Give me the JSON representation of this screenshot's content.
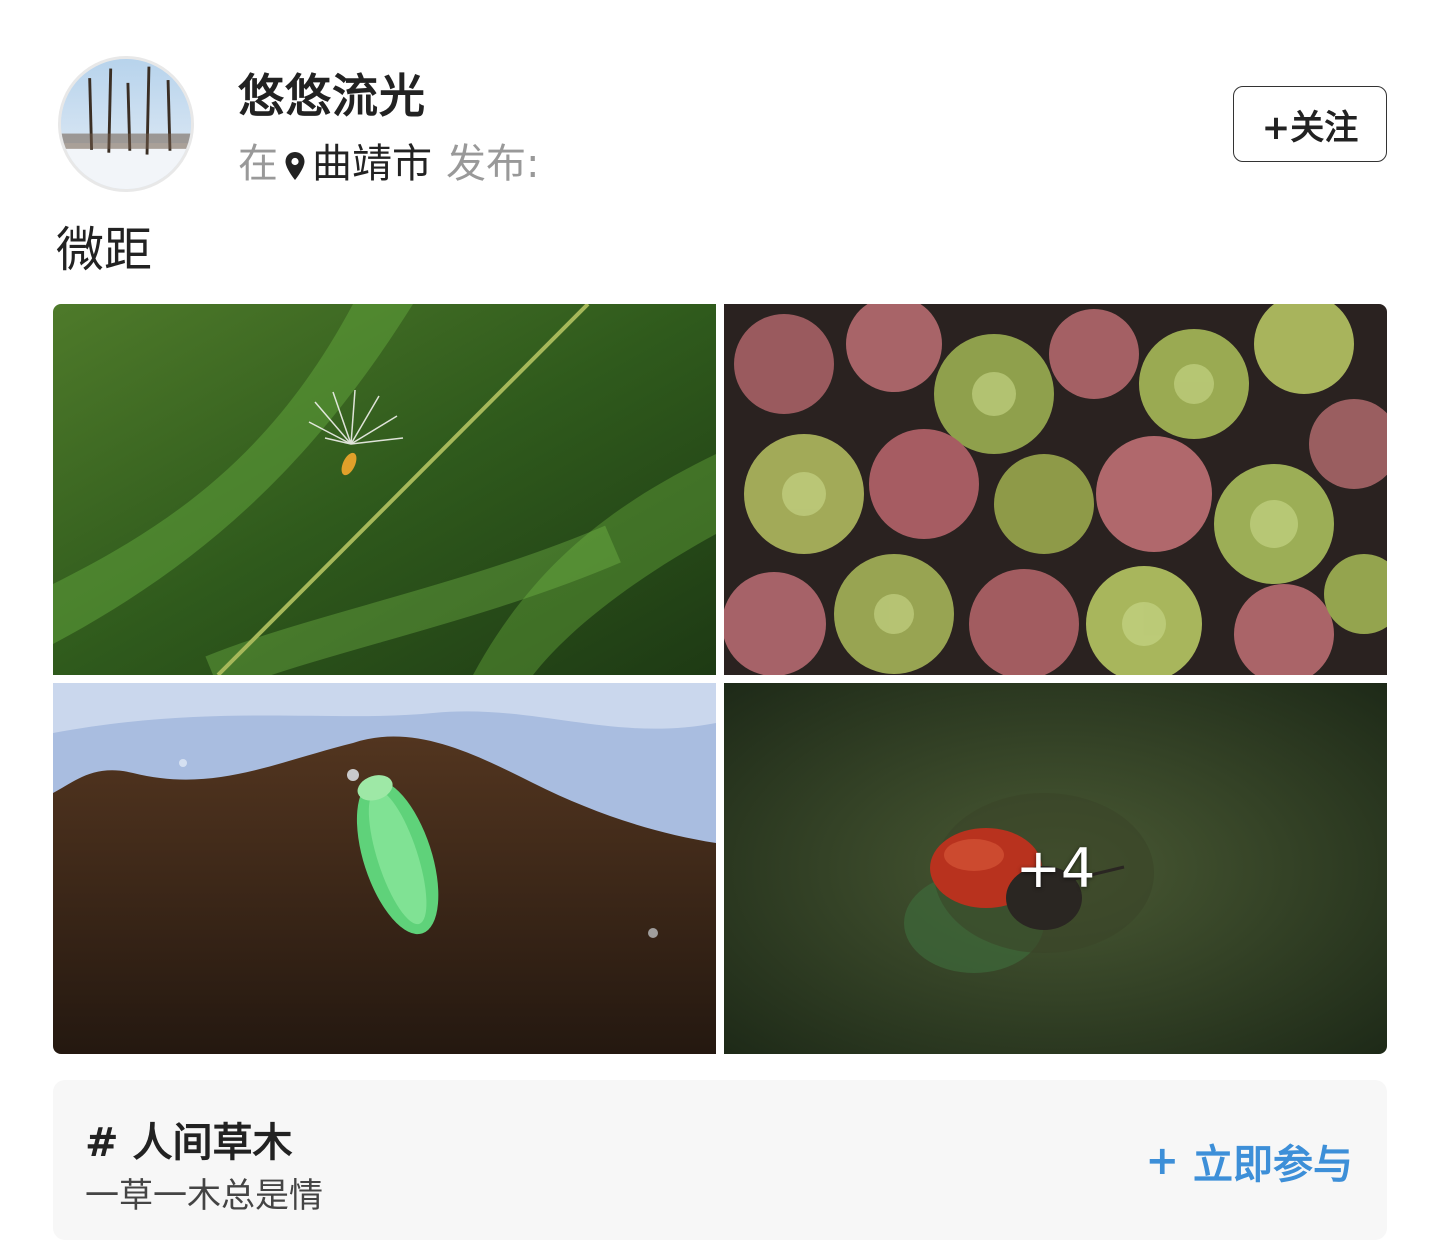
{
  "author": {
    "name": "悠悠流光",
    "location_prefix": "在",
    "location_icon": "map-pin-icon",
    "city": "曲靖市",
    "publish_label": "发布:"
  },
  "follow_button": {
    "label": "+关注"
  },
  "post": {
    "text": "微距",
    "images": [
      {
        "subject": "dandelion seed on grass stem"
      },
      {
        "subject": "red and green water fern"
      },
      {
        "subject": "green leafhopper insect"
      },
      {
        "subject": "red leaf beetle",
        "more_count_label": "+4"
      }
    ]
  },
  "topic": {
    "title": "# 人间草木",
    "description": "一草一木总是情",
    "join_icon": "plus-icon",
    "join_label": "立即参与"
  },
  "colors": {
    "accent": "#3d8fd8",
    "topic_background": "#f7f7f7"
  }
}
